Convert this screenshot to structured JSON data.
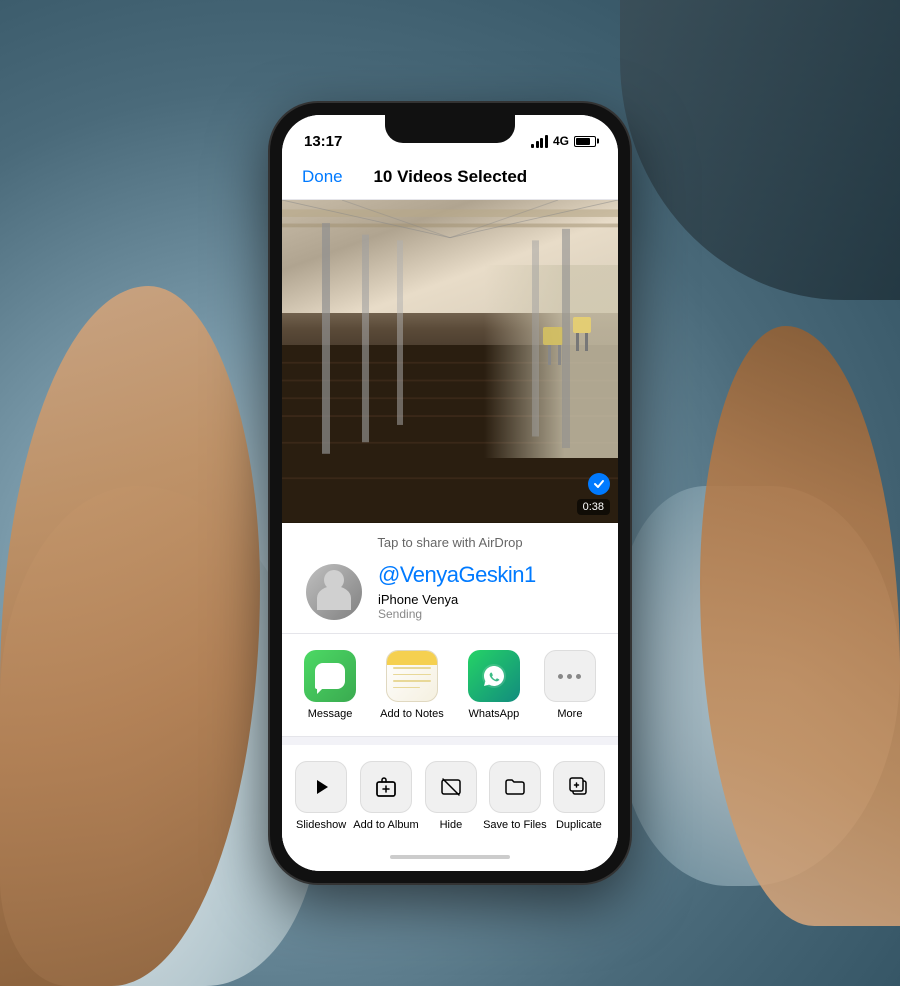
{
  "background": {
    "description": "Person holding iPhone outdoors near snowy rocky area"
  },
  "status_bar": {
    "time": "13:17",
    "signal_label": "4G",
    "battery_level": 80
  },
  "nav": {
    "done_label": "Done",
    "title": "10 Videos Selected"
  },
  "photo": {
    "duration": "0:38",
    "selected": true
  },
  "airdrop": {
    "tap_hint": "Tap to share with AirDrop",
    "username": "@VenyaGeskin1",
    "device_name": "iPhone Venya",
    "device_status": "Sending"
  },
  "share_apps": [
    {
      "id": "message",
      "label": "Message",
      "type": "message"
    },
    {
      "id": "notes",
      "label": "Add to Notes",
      "type": "notes"
    },
    {
      "id": "whatsapp",
      "label": "WhatsApp",
      "type": "whatsapp"
    },
    {
      "id": "more",
      "label": "More",
      "type": "more"
    }
  ],
  "actions": [
    {
      "id": "slideshow",
      "label": "Slideshow",
      "icon": "play"
    },
    {
      "id": "add-album",
      "label": "Add to Album",
      "icon": "plus-folder"
    },
    {
      "id": "hide",
      "label": "Hide",
      "icon": "hide"
    },
    {
      "id": "save-files",
      "label": "Save to Files",
      "icon": "folder"
    },
    {
      "id": "duplicate",
      "label": "Duplicate",
      "icon": "plus-folder2"
    }
  ]
}
